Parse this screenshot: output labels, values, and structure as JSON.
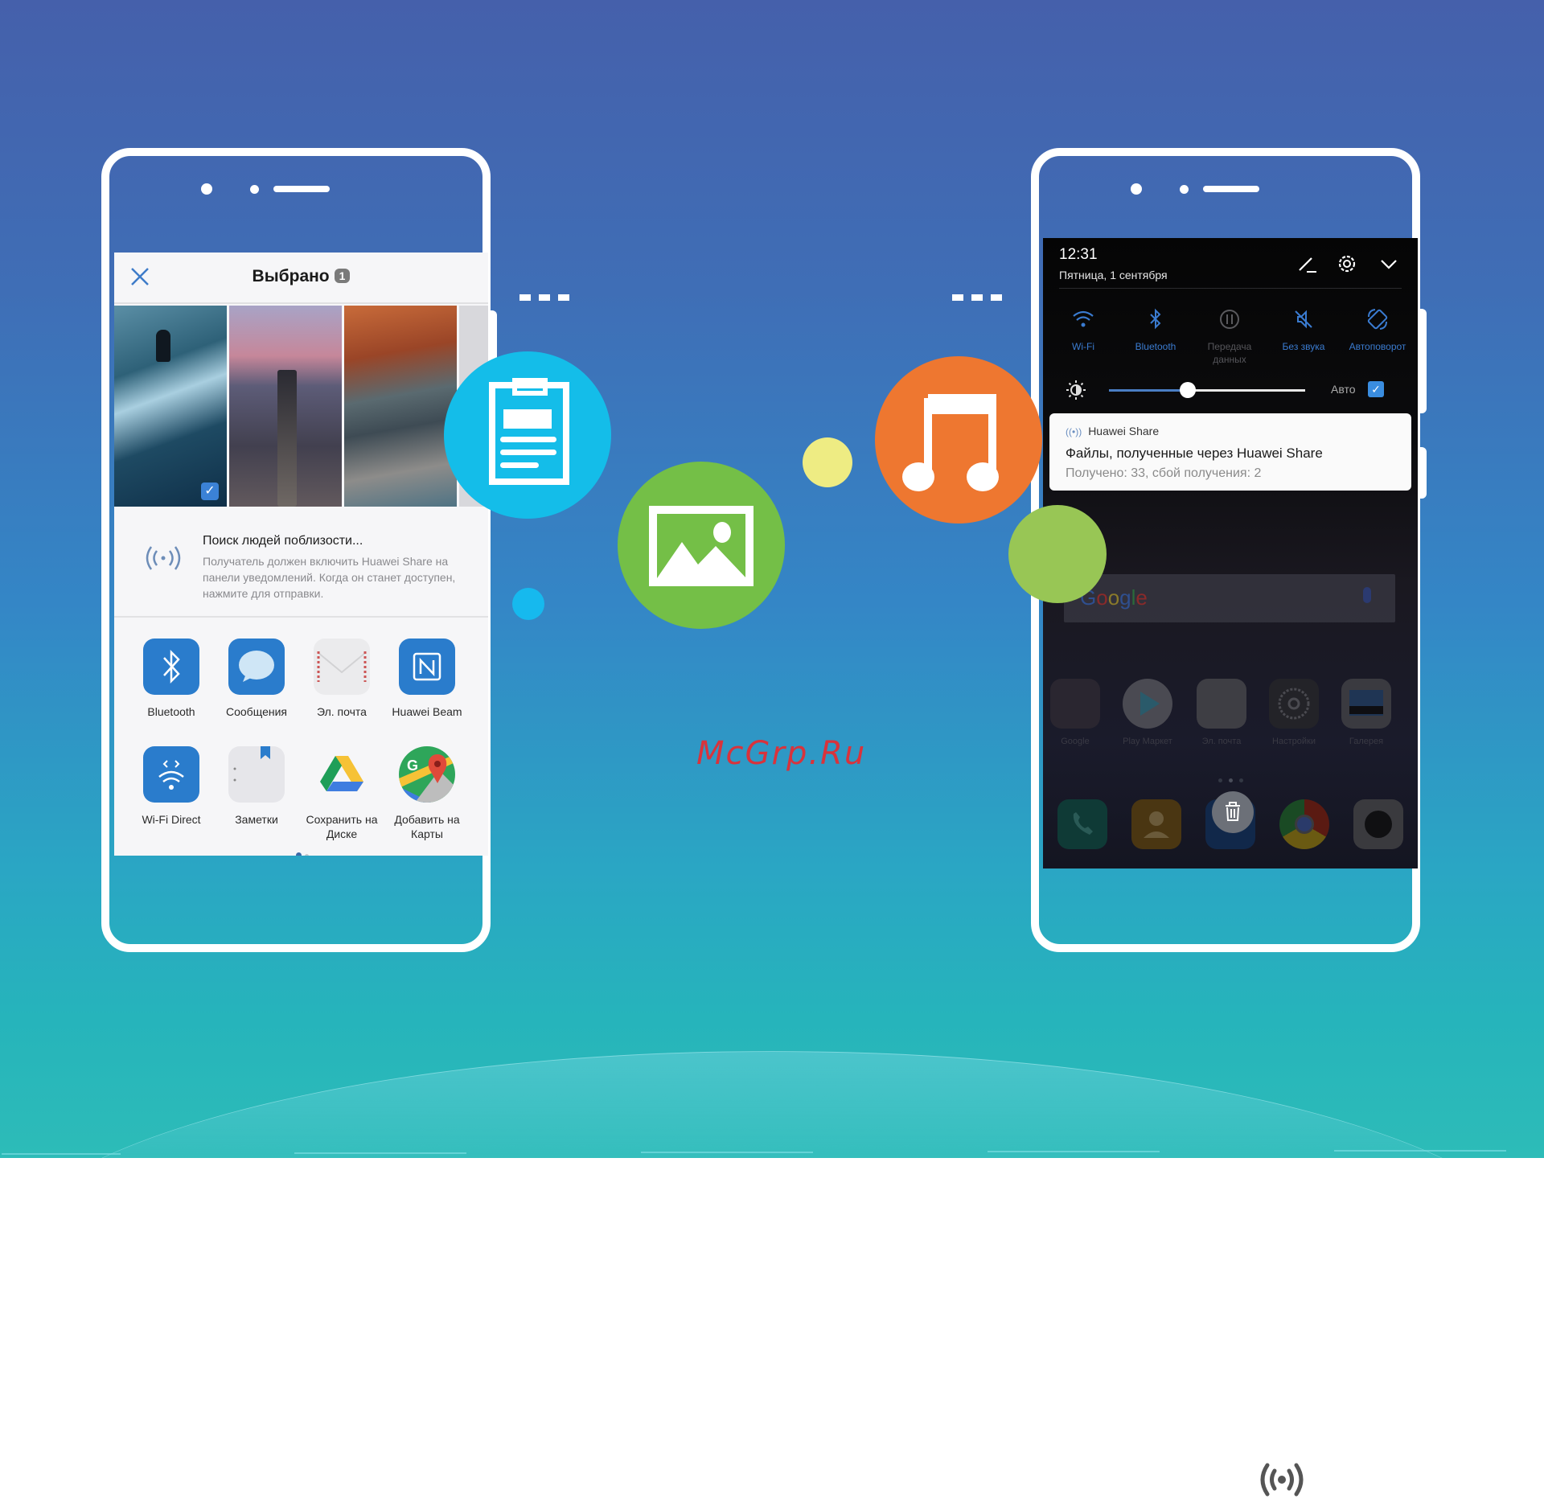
{
  "watermark": "McGrp.Ru",
  "colors": {
    "hero_top": "#4560ab",
    "hero_bottom": "#2dbcb8",
    "clipboard_bubble": "#14bde9",
    "image_bubble": "#74bf47",
    "music_bubble": "#ee7730",
    "yellow_dot": "#eeec83",
    "green_dot": "#98c655",
    "blue_dot": "#16b9ee",
    "watermark": "#d8333c"
  },
  "floating_icons": [
    {
      "name": "clipboard-icon"
    },
    {
      "name": "image-icon"
    },
    {
      "name": "music-note-icon"
    }
  ],
  "left_phone": {
    "header": {
      "title": "Выбрано",
      "badge": "1",
      "close_icon": "close-icon"
    },
    "photos": [
      {
        "name": "surfer-photo",
        "selected": true
      },
      {
        "name": "pier-sunset-photo",
        "selected": false
      },
      {
        "name": "autumn-leaves-photo",
        "selected": false
      }
    ],
    "nearby": {
      "title": "Поиск людей поблизости...",
      "description": "Получатель должен включить Huawei Share на панели уведомлений. Когда он станет доступен, нажмите для отправки."
    },
    "share_targets": [
      {
        "label": "Bluetooth",
        "icon": "bluetooth-icon"
      },
      {
        "label": "Сообщения",
        "icon": "messages-icon"
      },
      {
        "label": "Эл. почта",
        "icon": "email-icon"
      },
      {
        "label": "Huawei Beam",
        "icon": "nfc-icon"
      },
      {
        "label": "Wi-Fi Direct",
        "icon": "wifi-direct-icon"
      },
      {
        "label": "Заметки",
        "icon": "notes-icon"
      },
      {
        "label": "Сохранить на Диске",
        "icon": "google-drive-icon"
      },
      {
        "label": "Добавить на Карты",
        "icon": "google-maps-icon"
      }
    ],
    "page_indicator": {
      "current": 1,
      "total": 2
    }
  },
  "right_phone": {
    "status": {
      "time": "12:31",
      "date": "Пятница, 1 сентября"
    },
    "header_icons": [
      "edit-icon",
      "settings-icon",
      "chevron-down-icon"
    ],
    "toggles": [
      {
        "label": "Wi-Fi",
        "icon": "wifi-icon",
        "active": true
      },
      {
        "label": "Bluetooth",
        "icon": "bluetooth-icon",
        "active": true
      },
      {
        "label": "Передача данных",
        "icon": "mobile-data-icon",
        "active": false
      },
      {
        "label": "Без звука",
        "icon": "mute-icon",
        "active": true
      },
      {
        "label": "Автоповорот",
        "icon": "auto-rotate-icon",
        "active": true
      }
    ],
    "brightness": {
      "level": 0.4,
      "auto_label": "Авто",
      "auto_checked": true
    },
    "notification": {
      "app": "Huawei Share",
      "title": "Файлы, полученные через Huawei Share",
      "body": "Получено: 33, сбой получения: 2"
    },
    "search": {
      "logo": "Google"
    },
    "home_apps": [
      {
        "label": "Google"
      },
      {
        "label": "Play Маркет"
      },
      {
        "label": "Эл. почта"
      },
      {
        "label": "Настройки"
      },
      {
        "label": "Галерея"
      }
    ],
    "dock": [
      "phone-icon",
      "contacts-icon",
      "trash-icon",
      "chrome-icon",
      "camera-icon"
    ]
  },
  "footer_icon": "huawei-share-icon"
}
